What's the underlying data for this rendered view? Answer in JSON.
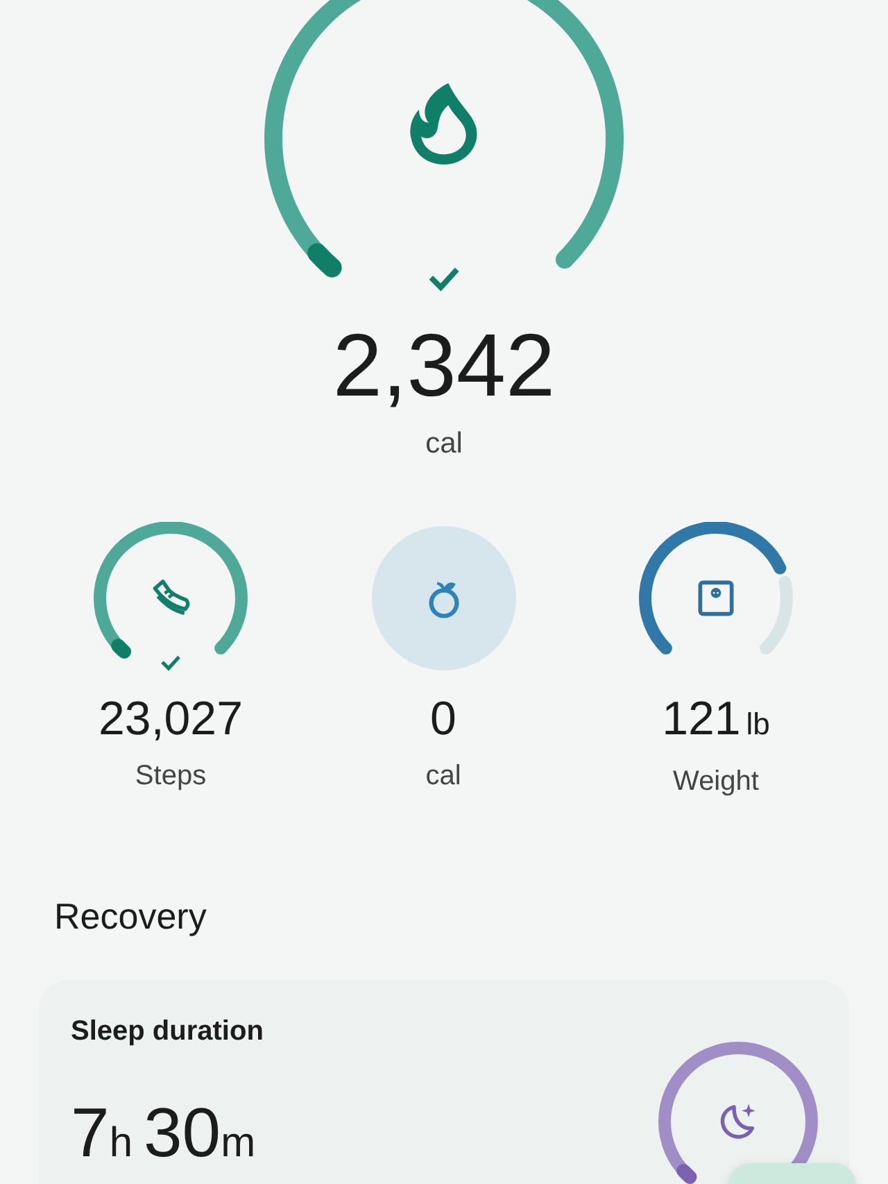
{
  "calories": {
    "value": "2,342",
    "unit": "cal",
    "goal_met": true
  },
  "metrics": [
    {
      "kind": "steps",
      "value": "23,027",
      "label": "Steps",
      "goal_met": true
    },
    {
      "kind": "food",
      "value": "0",
      "label": "cal"
    },
    {
      "kind": "weight",
      "value": "121",
      "unit": "lb",
      "label": "Weight"
    }
  ],
  "recovery": {
    "title": "Recovery",
    "card": {
      "title": "Sleep duration",
      "hours": "7",
      "hours_unit": "h",
      "minutes": "30",
      "minutes_unit": "m"
    }
  }
}
